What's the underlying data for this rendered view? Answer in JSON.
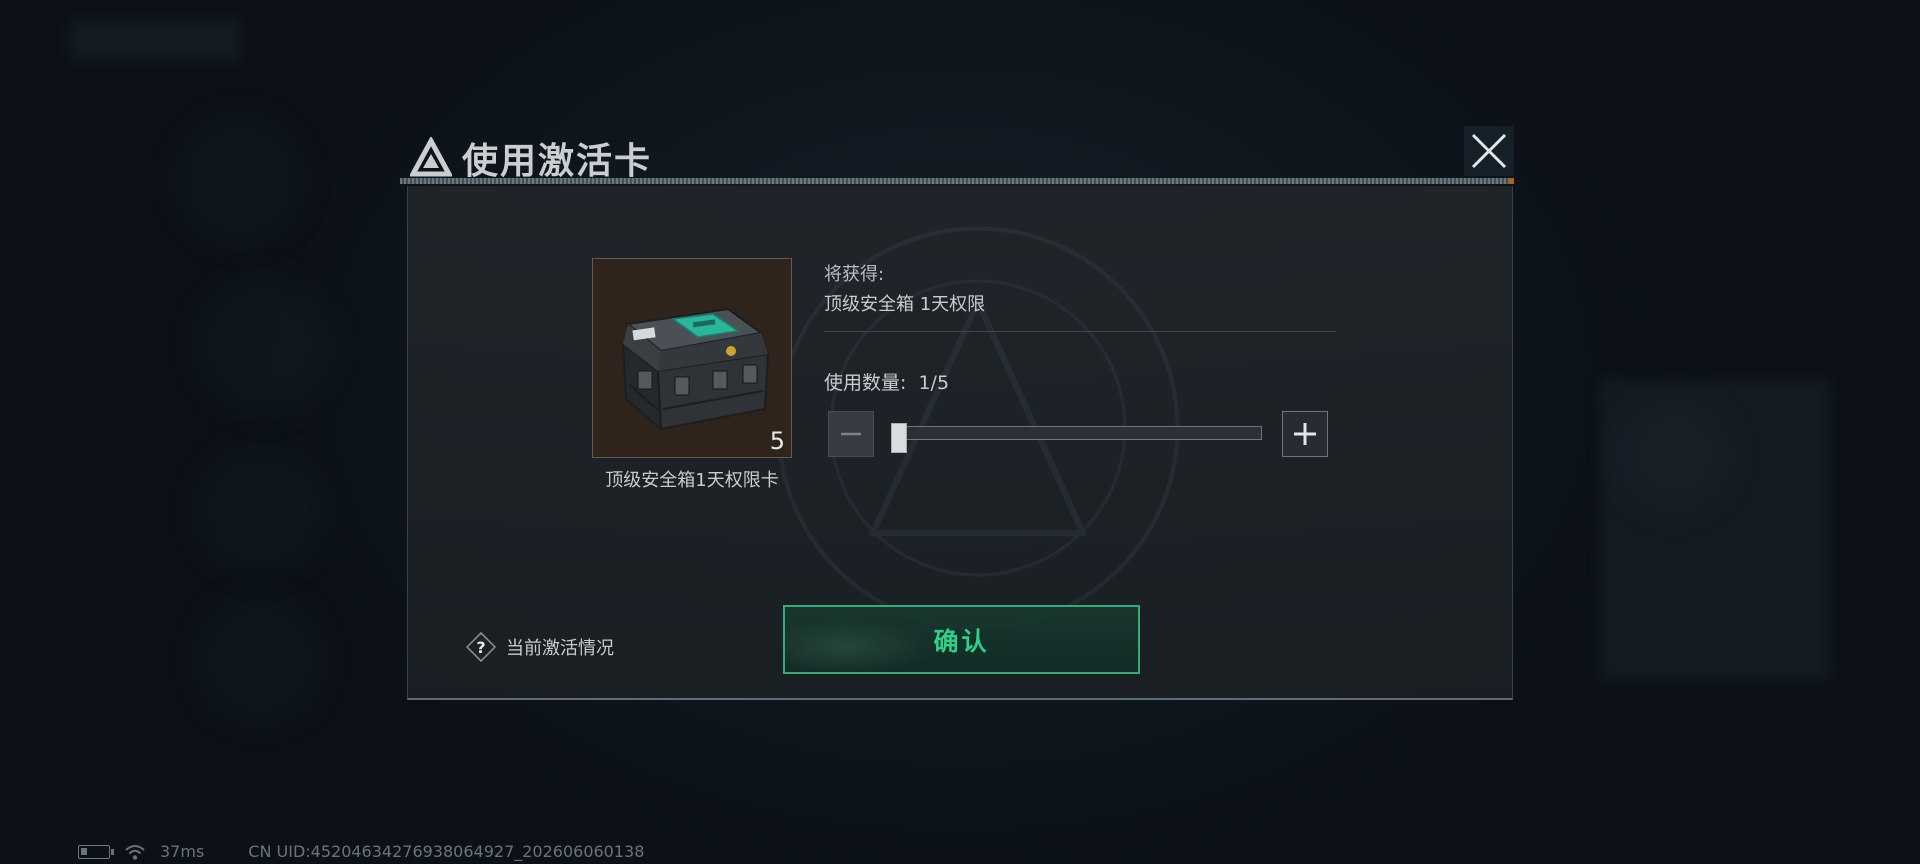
{
  "dialog": {
    "title": "使用激活卡"
  },
  "item": {
    "name": "顶级安全箱1天权限卡",
    "count": "5",
    "icon": "secure-case-icon"
  },
  "reward": {
    "label": "将获得:",
    "value": "顶级安全箱 1天权限"
  },
  "quantity": {
    "label": "使用数量:",
    "display": "1/5",
    "current": 1,
    "max": 5
  },
  "help": {
    "label": "当前激活情况"
  },
  "confirm": {
    "label": "确认"
  },
  "status_bar": {
    "ping": "37ms",
    "uid": "CN UID:45204634276938064927_202606060138"
  },
  "colors": {
    "accent": "#2ecf86",
    "confirm_border": "#2fae78",
    "header_accent": "#b9781f"
  }
}
